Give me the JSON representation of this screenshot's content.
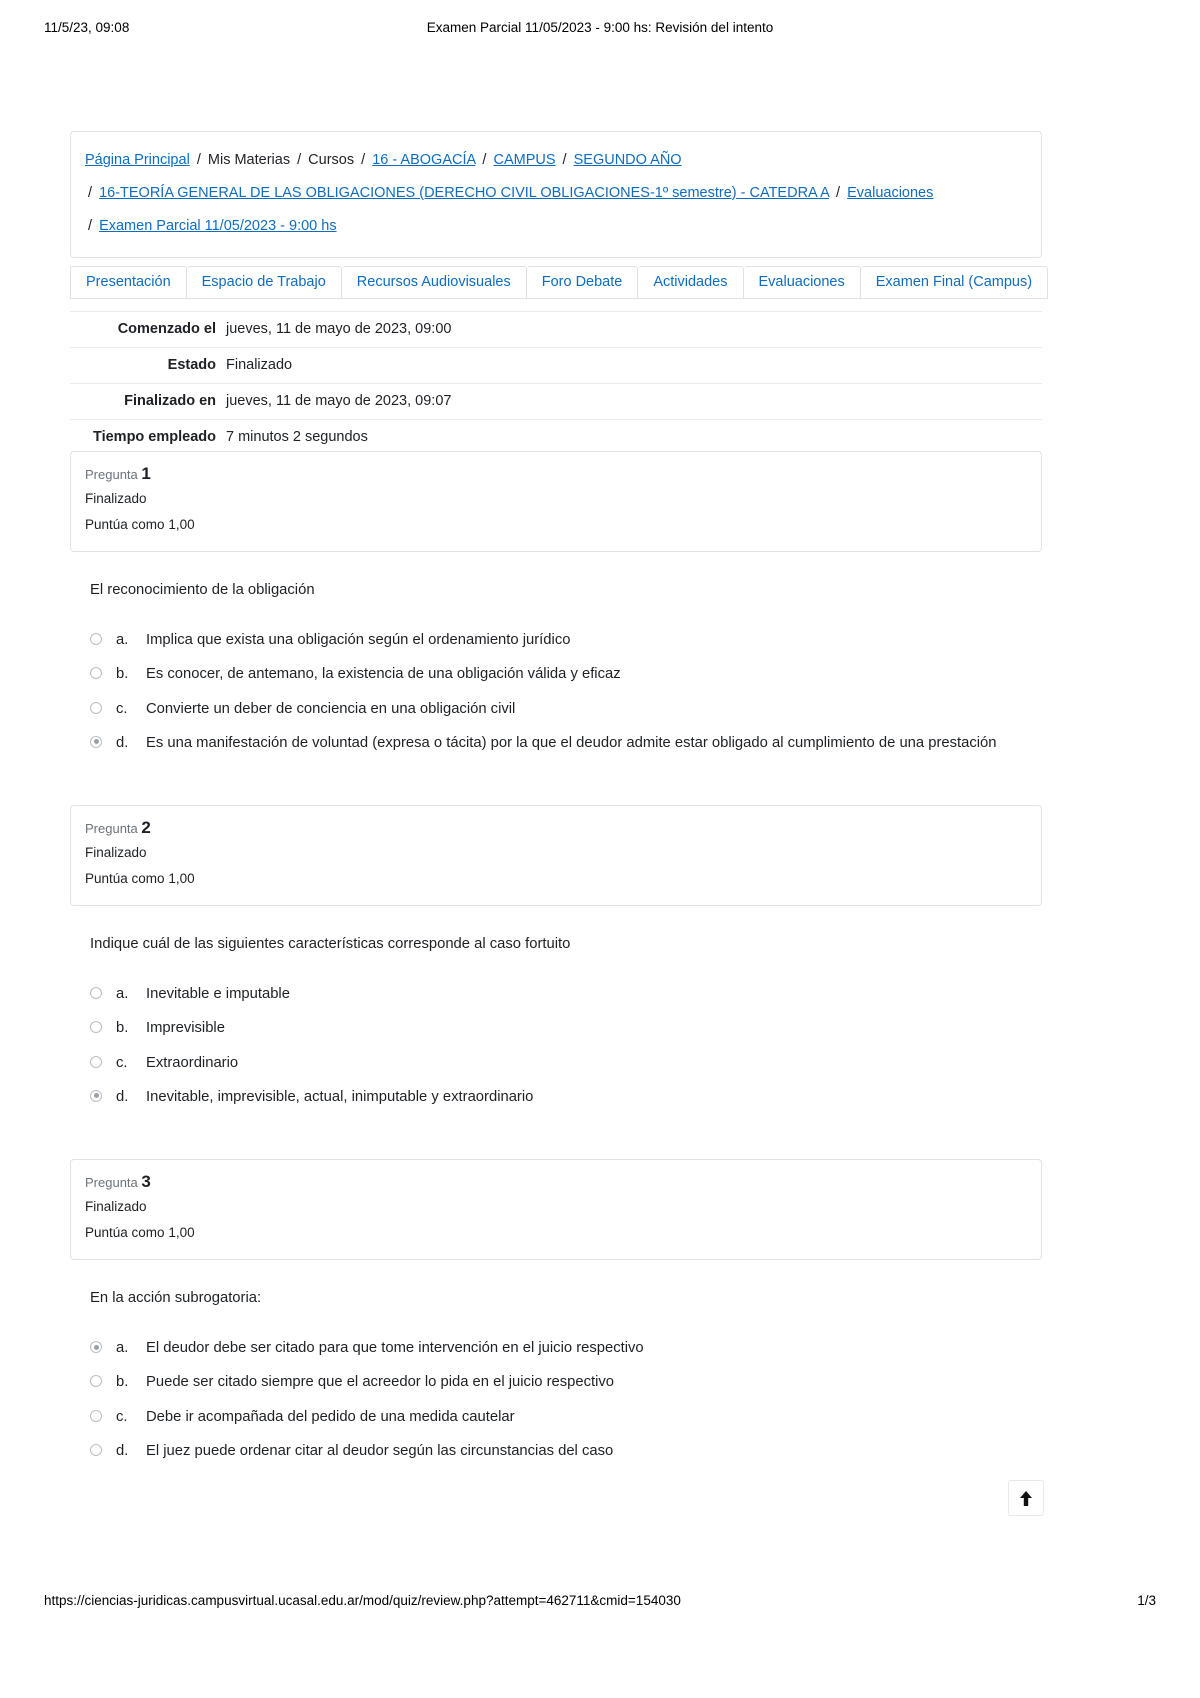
{
  "print": {
    "header_date": "11/5/23, 09:08",
    "header_title": "Examen Parcial 11/05/2023 - 9:00 hs: Revisión del intento",
    "footer_url": "https://ciencias-juridicas.campusvirtual.ucasal.edu.ar/mod/quiz/review.php?attempt=462711&cmid=154030",
    "footer_page": "1/3"
  },
  "breadcrumb": {
    "line1": [
      {
        "text": "Página Principal",
        "link": true
      },
      {
        "text": "/",
        "sep": true
      },
      {
        "text": "Mis Materias",
        "link": false
      },
      {
        "text": "/",
        "sep": true
      },
      {
        "text": "Cursos",
        "link": false
      },
      {
        "text": "/",
        "sep": true
      },
      {
        "text": "16 - ABOGACÍA",
        "link": true
      },
      {
        "text": "/",
        "sep": true
      },
      {
        "text": "CAMPUS",
        "link": true
      },
      {
        "text": "/",
        "sep": true
      },
      {
        "text": "SEGUNDO AÑO",
        "link": true
      }
    ],
    "line2": [
      {
        "text": "/",
        "sep": true
      },
      {
        "text": "16-TEORÍA GENERAL DE LAS OBLIGACIONES (DERECHO CIVIL OBLIGACIONES-1º semestre) - CATEDRA A",
        "link": true
      },
      {
        "text": "/",
        "sep": true
      },
      {
        "text": "Evaluaciones",
        "link": true
      }
    ],
    "line3": [
      {
        "text": "/",
        "sep": true
      },
      {
        "text": "Examen Parcial 11/05/2023 - 9:00 hs",
        "link": true
      }
    ]
  },
  "tabs": [
    {
      "label": "Presentación"
    },
    {
      "label": "Espacio de Trabajo"
    },
    {
      "label": "Recursos Audiovisuales"
    },
    {
      "label": "Foro Debate"
    },
    {
      "label": "Actividades"
    },
    {
      "label": "Evaluaciones"
    },
    {
      "label": "Examen Final (Campus)"
    }
  ],
  "attempt_info": [
    {
      "label": "Comenzado el",
      "value": "jueves, 11 de mayo de 2023, 09:00"
    },
    {
      "label": "Estado",
      "value": "Finalizado"
    },
    {
      "label": "Finalizado en",
      "value": "jueves, 11 de mayo de 2023, 09:07"
    },
    {
      "label": "Tiempo empleado",
      "value": "7 minutos 2 segundos"
    }
  ],
  "questions": [
    {
      "number_label": "Pregunta",
      "number": "1",
      "state": "Finalizado",
      "marks_label": "Puntúa como",
      "marks_value": "1,00",
      "text": "El reconocimiento de la obligación",
      "options": [
        {
          "letter": "a.",
          "text": "Implica que exista una obligación según el ordenamiento jurídico",
          "selected": false
        },
        {
          "letter": "b.",
          "text": "Es conocer, de antemano, la existencia de una obligación válida y eficaz",
          "selected": false
        },
        {
          "letter": "c.",
          "text": "Convierte un deber de conciencia en una obligación civil",
          "selected": false
        },
        {
          "letter": "d.",
          "text": "Es una manifestación de voluntad (expresa o tácita) por la que el deudor admite estar obligado al cumplimiento de una prestación",
          "selected": true
        }
      ]
    },
    {
      "number_label": "Pregunta",
      "number": "2",
      "state": "Finalizado",
      "marks_label": "Puntúa como",
      "marks_value": "1,00",
      "text": "Indique cuál de las siguientes características corresponde al caso fortuito",
      "options": [
        {
          "letter": "a.",
          "text": "Inevitable e imputable",
          "selected": false
        },
        {
          "letter": "b.",
          "text": "Imprevisible",
          "selected": false
        },
        {
          "letter": "c.",
          "text": "Extraordinario",
          "selected": false
        },
        {
          "letter": "d.",
          "text": "Inevitable, imprevisible, actual, inimputable y extraordinario",
          "selected": true
        }
      ]
    },
    {
      "number_label": "Pregunta",
      "number": "3",
      "state": "Finalizado",
      "marks_label": "Puntúa como",
      "marks_value": "1,00",
      "text": "En la acción subrogatoria:",
      "options": [
        {
          "letter": "a.",
          "text": "El deudor debe ser citado para que tome intervención en el juicio respectivo",
          "selected": true
        },
        {
          "letter": "b.",
          "text": "Puede ser citado siempre que el acreedor lo pida en el juicio respectivo",
          "selected": false
        },
        {
          "letter": "c.",
          "text": "Debe ir acompañada del pedido de una medida cautelar",
          "selected": false
        },
        {
          "letter": "d.",
          "text": "El juez puede ordenar citar al deudor según las circunstancias del caso",
          "selected": false
        }
      ]
    }
  ],
  "scroll_top_button": {
    "icon": "arrow-up-icon",
    "label": "↑"
  },
  "colors": {
    "link": "#0f6cbf",
    "text": "#1d2125",
    "muted": "#6a737c",
    "border": "#e0e2e4"
  }
}
